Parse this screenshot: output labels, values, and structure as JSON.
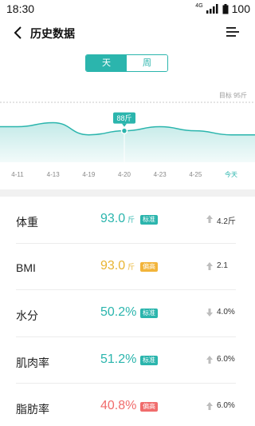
{
  "status_bar": {
    "time": "18:30",
    "network": "4G",
    "battery": "100"
  },
  "header": {
    "title": "历史数据"
  },
  "period_tabs": [
    {
      "label": "天",
      "active": true
    },
    {
      "label": "周",
      "active": false
    }
  ],
  "colors": {
    "accent": "#2bb5ad",
    "normal": "#2bb5ad",
    "high": "#f2b43a",
    "alert": "#f06c6c",
    "bmi_value": "#e8b431",
    "weight_value": "#2bb5ad"
  },
  "chart_data": {
    "type": "area",
    "x": [
      "4-11",
      "4-13",
      "4-19",
      "4-20",
      "4-23",
      "4-25",
      "今天"
    ],
    "values": [
      89,
      90,
      87,
      88,
      89,
      88,
      87
    ],
    "highlight": {
      "x": "4-20",
      "label": "88斤"
    },
    "target": {
      "label": "目标 95斤",
      "value": 95
    },
    "today_label_color": "#2bb5ad"
  },
  "metrics": [
    {
      "label": "体重",
      "value": "93.0",
      "unit": "斤",
      "badge": "标准",
      "badge_color": "#2bb5ad",
      "value_color": "#2bb5ad",
      "trend": "up",
      "delta": "4.2斤"
    },
    {
      "label": "BMI",
      "value": "93.0",
      "unit": "斤",
      "badge": "偏高",
      "badge_color": "#f2b43a",
      "value_color": "#e8b431",
      "trend": "up",
      "delta": "2.1"
    },
    {
      "label": "水分",
      "value": "50.2%",
      "unit": "",
      "badge": "标准",
      "badge_color": "#2bb5ad",
      "value_color": "#2bb5ad",
      "trend": "down",
      "delta": "4.0%"
    },
    {
      "label": "肌肉率",
      "value": "51.2%",
      "unit": "",
      "badge": "标准",
      "badge_color": "#2bb5ad",
      "value_color": "#2bb5ad",
      "trend": "up",
      "delta": "6.0%"
    },
    {
      "label": "脂肪率",
      "value": "40.8%",
      "unit": "",
      "badge": "偏高",
      "badge_color": "#f06c6c",
      "value_color": "#f06c6c",
      "trend": "up",
      "delta": "6.0%"
    }
  ]
}
